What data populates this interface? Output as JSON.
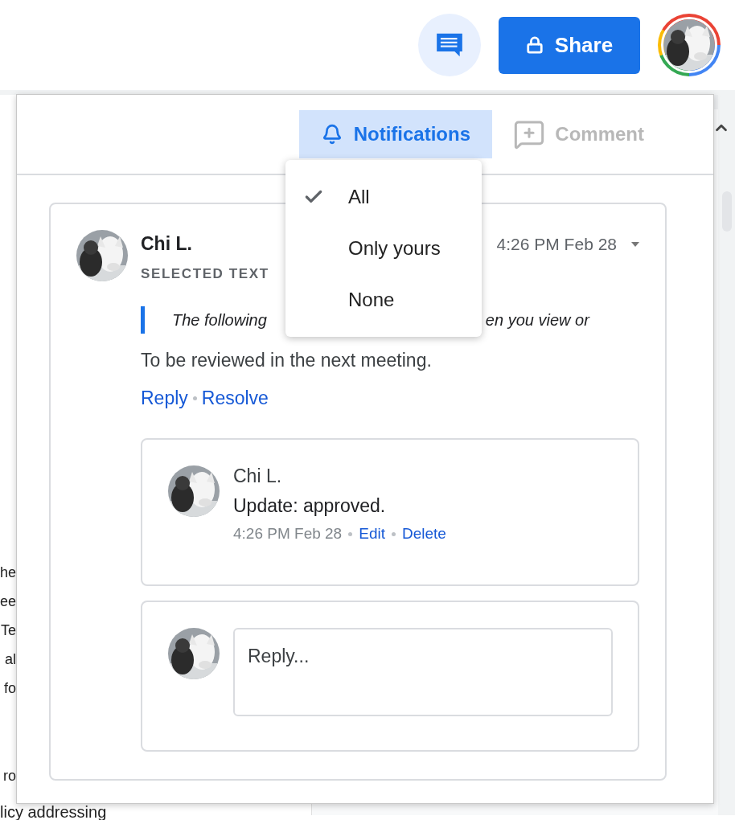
{
  "toolbar": {
    "share_button": "Share"
  },
  "document": {
    "lines": [
      "he",
      "ee",
      "Te",
      "al",
      "fo",
      "ro"
    ],
    "last_line": "licy addressing"
  },
  "comments_panel": {
    "notifications_button": {
      "label": "Notifications",
      "expanded": true
    },
    "comment_button": {
      "label": "Comment",
      "disabled": true
    },
    "notification_menu": [
      {
        "label": "All",
        "selected": true
      },
      {
        "label": "Only yours",
        "selected": false
      },
      {
        "label": "None",
        "selected": false
      }
    ],
    "thread": {
      "author": "Chi L.",
      "time": "4:26 PM Feb 28",
      "selected_text_label": "SELECTED TEXT",
      "quoted_text": [
        "The following",
        "en you view or"
      ],
      "body": "To be reviewed in the next meeting.",
      "actions": [
        "Reply",
        "Resolve"
      ],
      "replies": [
        {
          "author": "Chi L.",
          "body": "Update: approved.",
          "time": "4:26 PM Feb 28",
          "actions": [
            "Edit",
            "Delete"
          ]
        }
      ],
      "reply_field": {
        "placeholder": "Reply..."
      }
    }
  }
}
